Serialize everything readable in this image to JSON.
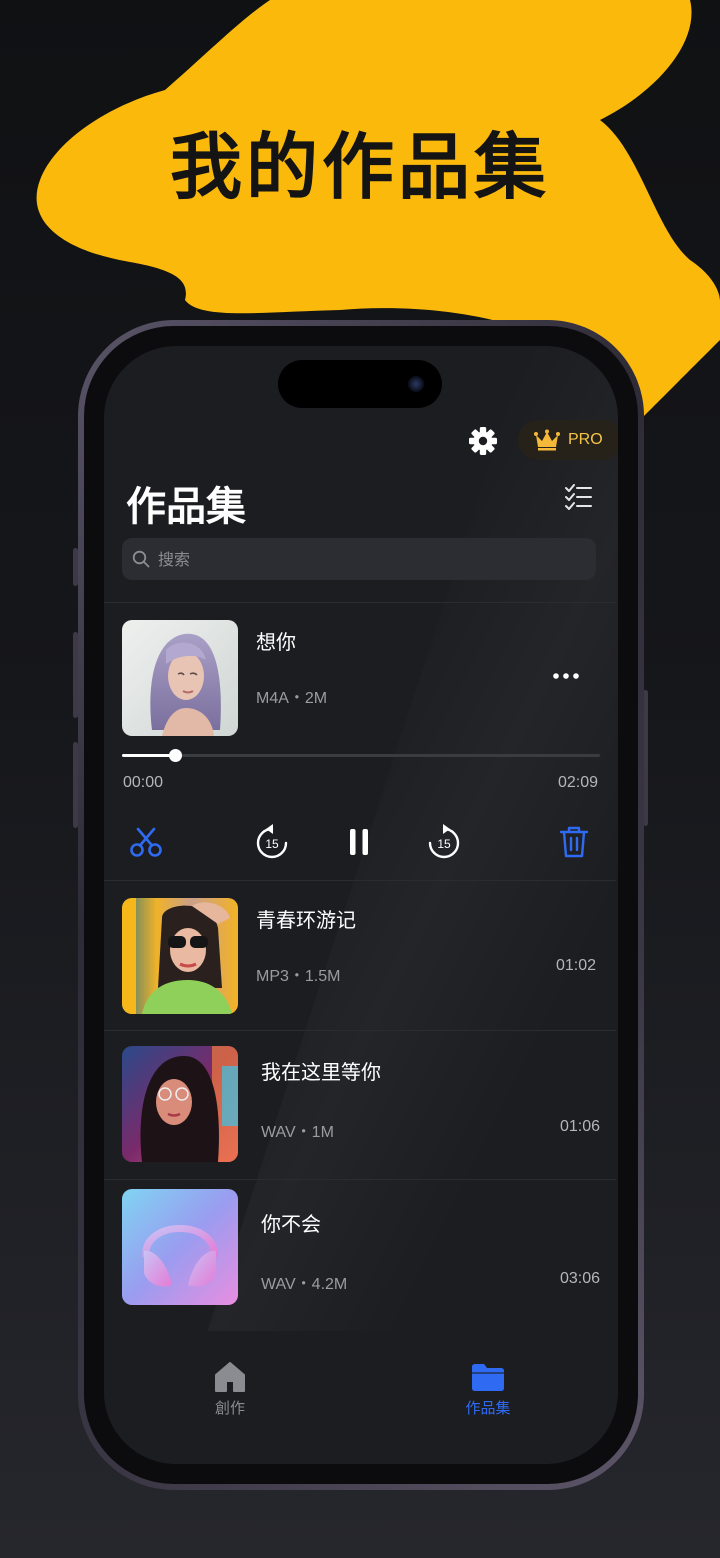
{
  "promo": {
    "title": "我的作品集"
  },
  "colors": {
    "accent_yellow": "#fbb90c",
    "accent_blue": "#2f6bf2",
    "pro_gold": "#f4c547"
  },
  "header": {
    "settings_icon": "gear-icon",
    "pro_badge": {
      "icon": "crown-icon",
      "label": "PRO"
    },
    "title": "作品集",
    "select_icon": "checklist-icon"
  },
  "search": {
    "placeholder": "搜索",
    "value": ""
  },
  "now_playing": {
    "title": "想你",
    "meta": "M4A・2M",
    "progress": 0.11,
    "current_time": "00:00",
    "total_time": "02:09",
    "controls": [
      "scissors-icon",
      "rewind-15-icon",
      "pause-icon",
      "forward-15-icon",
      "trash-icon"
    ],
    "skip_seconds": "15"
  },
  "tracks": [
    {
      "title": "青春环游记",
      "meta": "MP3・1.5M",
      "duration": "01:02"
    },
    {
      "title": "我在这里等你",
      "meta": "WAV・1M",
      "duration": "01:06"
    },
    {
      "title": "你不会",
      "meta": "WAV・4.2M",
      "duration": "03:06"
    }
  ],
  "tabbar": [
    {
      "label": "創作",
      "icon": "home-icon",
      "active": false
    },
    {
      "label": "作品集",
      "icon": "folder-icon",
      "active": true
    }
  ]
}
